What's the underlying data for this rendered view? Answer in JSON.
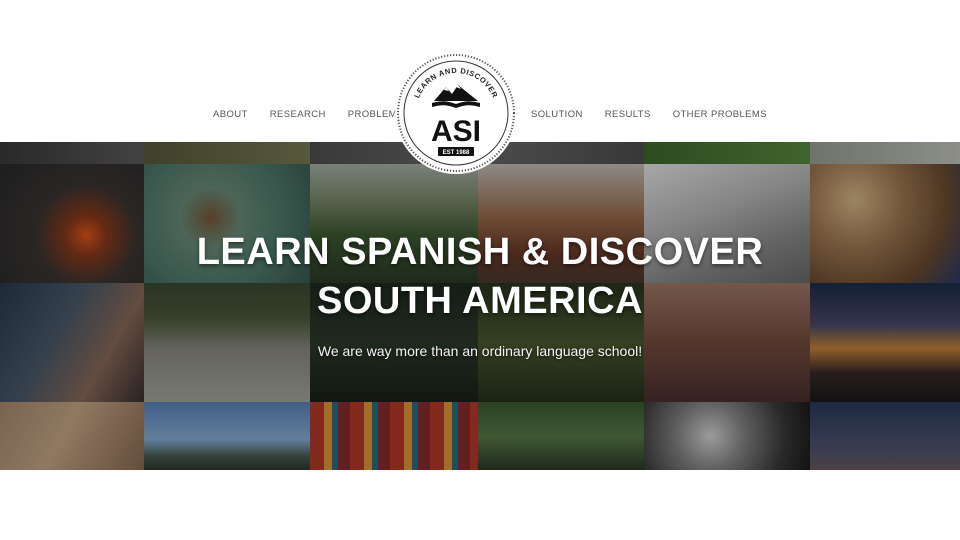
{
  "nav": {
    "left": [
      "ABOUT",
      "RESEARCH",
      "PROBLEM"
    ],
    "right": [
      "SOLUTION",
      "RESULTS",
      "OTHER PROBLEMS"
    ]
  },
  "logo": {
    "arc_text": "LEARN AND DISCOVER",
    "initials": "ASI",
    "est": "EST 1988"
  },
  "hero": {
    "title_line1": "LEARN SPANISH & DISCOVER",
    "title_line2": "SOUTH AMERICA",
    "subtitle": "We are way more than an ordinary language school!"
  },
  "colors": {
    "nav_text": "#555555",
    "hero_text": "#ffffff",
    "logo_ink": "#111111"
  }
}
